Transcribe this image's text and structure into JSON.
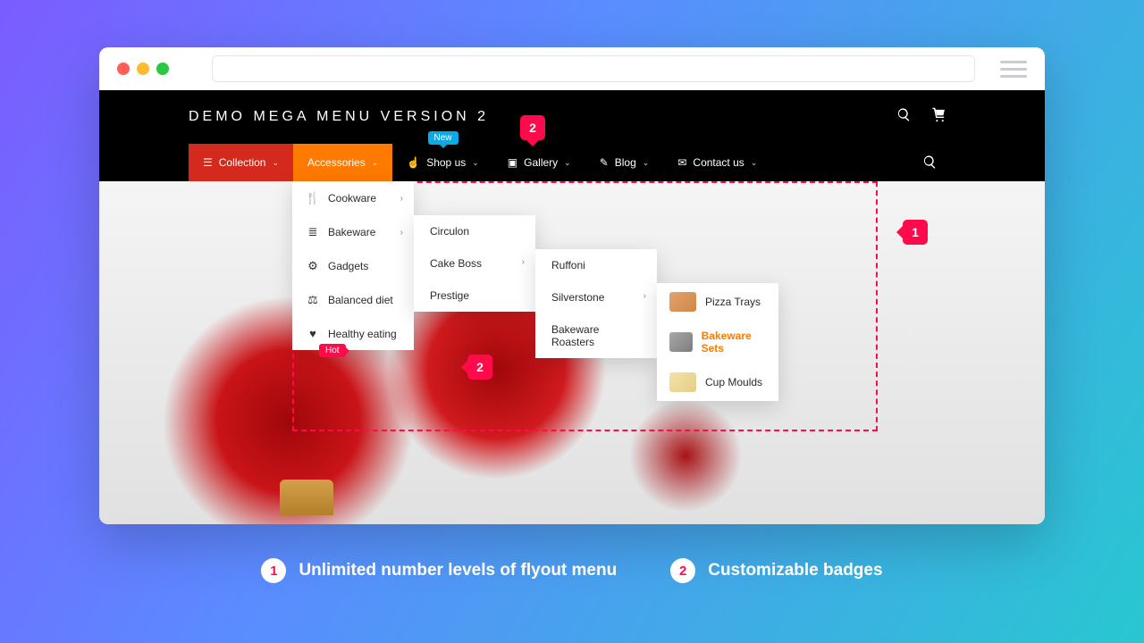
{
  "site": {
    "title": "DEMO MEGA MENU VERSION 2"
  },
  "nav": {
    "items": [
      {
        "label": "Collection"
      },
      {
        "label": "Accessories"
      },
      {
        "label": "Shop us",
        "badge": "New"
      },
      {
        "label": "Gallery"
      },
      {
        "label": "Blog"
      },
      {
        "label": "Contact us"
      }
    ]
  },
  "flyout1": {
    "items": [
      {
        "label": "Cookware"
      },
      {
        "label": "Bakeware"
      },
      {
        "label": "Gadgets"
      },
      {
        "label": "Balanced diet"
      },
      {
        "label": "Healthy eating",
        "badge": "Hot"
      }
    ]
  },
  "flyout2": {
    "items": [
      {
        "label": "Circulon"
      },
      {
        "label": "Cake Boss"
      },
      {
        "label": "Prestige"
      }
    ]
  },
  "flyout3": {
    "items": [
      {
        "label": "Ruffoni"
      },
      {
        "label": "Silverstone"
      },
      {
        "label": "Bakeware Roasters"
      }
    ]
  },
  "flyout4": {
    "items": [
      {
        "label": "Pizza Trays"
      },
      {
        "label": "Bakeware Sets"
      },
      {
        "label": "Cup Moulds"
      }
    ]
  },
  "callouts": {
    "flyout": "1",
    "badge_top": "2",
    "badge_hot": "2"
  },
  "legend": [
    {
      "num": "1",
      "text": "Unlimited number levels of flyout menu"
    },
    {
      "num": "2",
      "text": "Customizable badges"
    }
  ]
}
